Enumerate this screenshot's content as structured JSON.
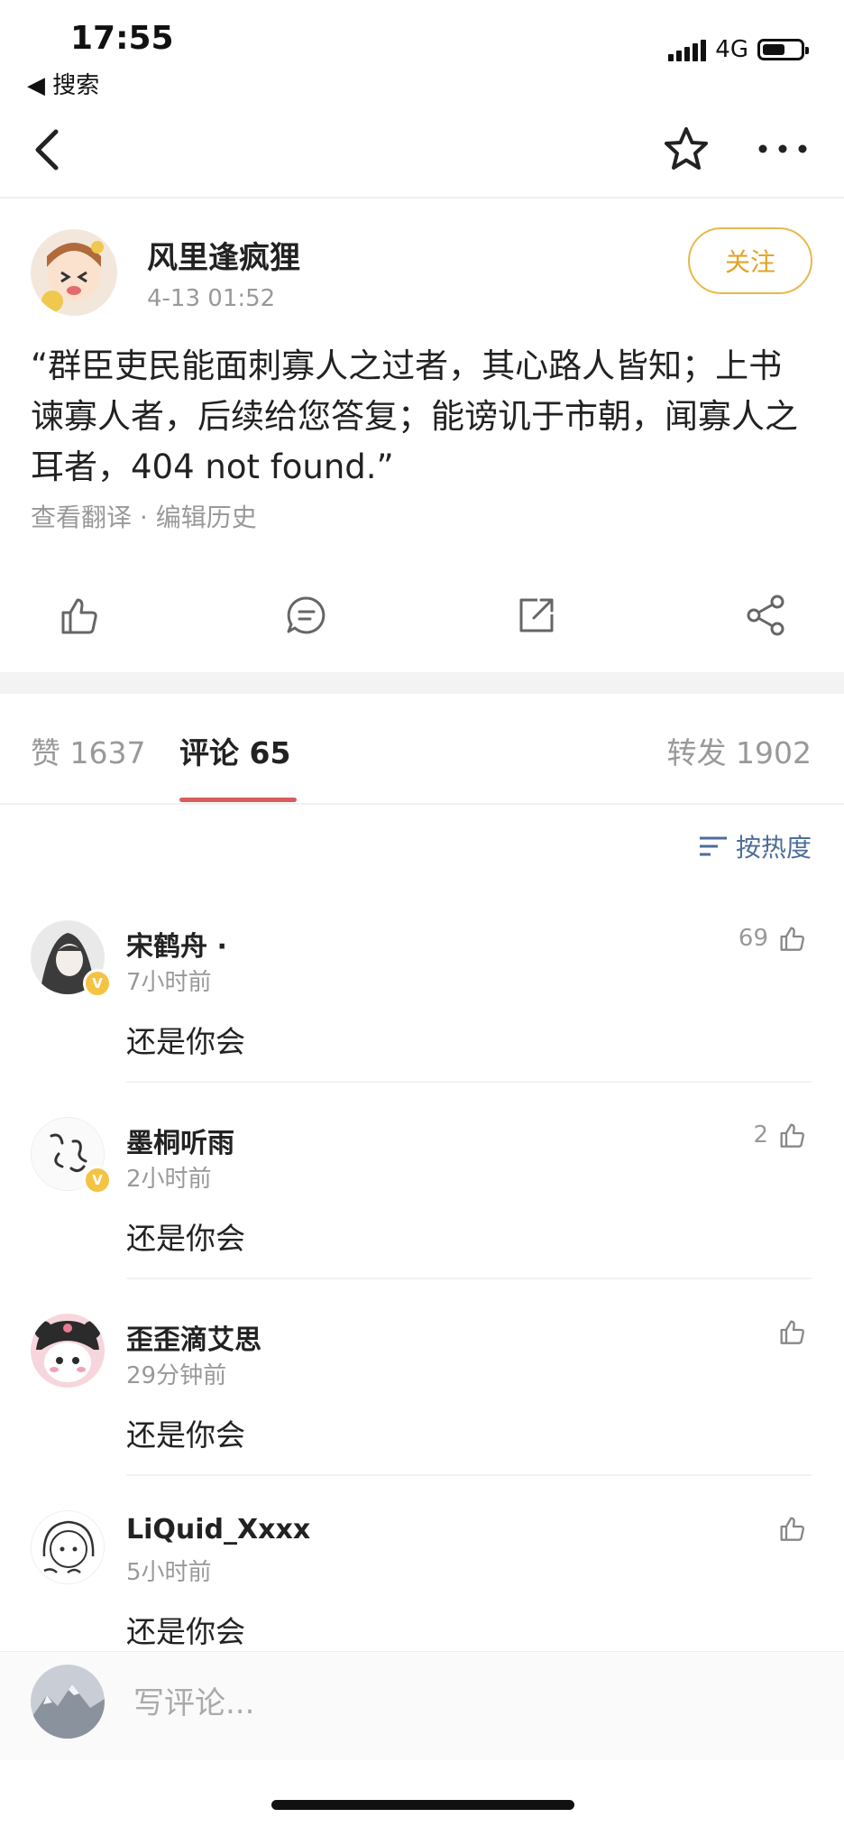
{
  "status": {
    "time": "17:55",
    "back_app": "搜索",
    "network": "4G"
  },
  "nav": {
    "back_icon": "back-arrow-icon",
    "star_icon": "star-icon",
    "more_icon": "more-icon"
  },
  "post": {
    "author": "风里逢疯狸",
    "time": "4-13 01:52",
    "follow_label": "关注",
    "text": "“群臣吏民能面刺寡人之过者，其心路人皆知；上书谏寡人者，后续给您答复；能谤讥于市朝，闻寡人之耳者，404 not found.”",
    "meta": "查看翻译 · 编辑历史"
  },
  "tabs": {
    "likes": "赞 1637",
    "comments": "评论 65",
    "reposts": "转发 1902"
  },
  "sort_label": "按热度",
  "comments": [
    {
      "name": "宋鹤舟 ·",
      "time": "7小时前",
      "text": "还是你会",
      "likes": "69",
      "verified": true
    },
    {
      "name": "墨桐听雨",
      "time": "2小时前",
      "text": "还是你会",
      "likes": "2",
      "verified": true
    },
    {
      "name": "歪歪滴艾思",
      "time": "29分钟前",
      "text": "还是你会",
      "likes": "",
      "verified": false
    },
    {
      "name": "LiQuid_Xxxx",
      "time": "5小时前",
      "text": "还是你会",
      "likes": "",
      "verified": false
    }
  ],
  "input_placeholder": "写评论...",
  "colors": {
    "accent_follow": "#e3a428",
    "tab_underline": "#d95d5d",
    "sort_link": "#4e6d99"
  }
}
